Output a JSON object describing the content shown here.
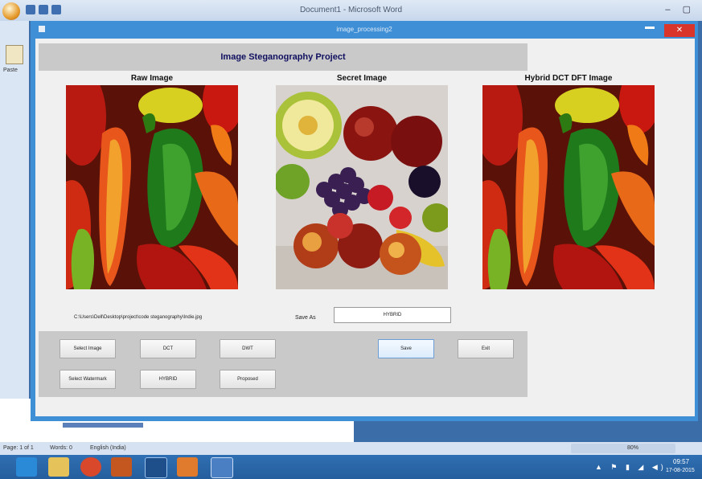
{
  "word": {
    "title": "Document1 - Microsoft Word",
    "controls": "– ▢",
    "paste_label": "Paste",
    "status": {
      "page": "Page: 1 of 1",
      "words": "Words: 0",
      "language": "English (India)",
      "zoom": "80%"
    }
  },
  "figure": {
    "window_title": "image_processing2",
    "close_glyph": "✕",
    "project_title": "Image Steganography Project",
    "panels": [
      {
        "label": "Raw Image"
      },
      {
        "label": "Secret Image"
      },
      {
        "label": "Hybrid DCT DFT Image"
      }
    ],
    "file_path": "C:\\Users\\Dell\\Desktop\\project\\code steganography\\Indie.jpg",
    "save_as_label": "Save As",
    "save_as_value": "HYBRID",
    "buttons": {
      "select_image": "Select Image",
      "dct": "DCT",
      "dwt": "DWT",
      "save": "Save",
      "exit": "Exit",
      "select_watermark": "Select Watermark",
      "hybrid": "HYBRID",
      "proposed": "Proposed"
    }
  },
  "taskbar": {
    "clock_time": "09:57",
    "clock_date": "17-08-2015",
    "tray_icons": "▲ ⚑ ▮ ◢ ◀)"
  },
  "colors": {
    "accent": "#3f8fd6",
    "panel": "#c9c9c9",
    "close": "#d9352a"
  }
}
